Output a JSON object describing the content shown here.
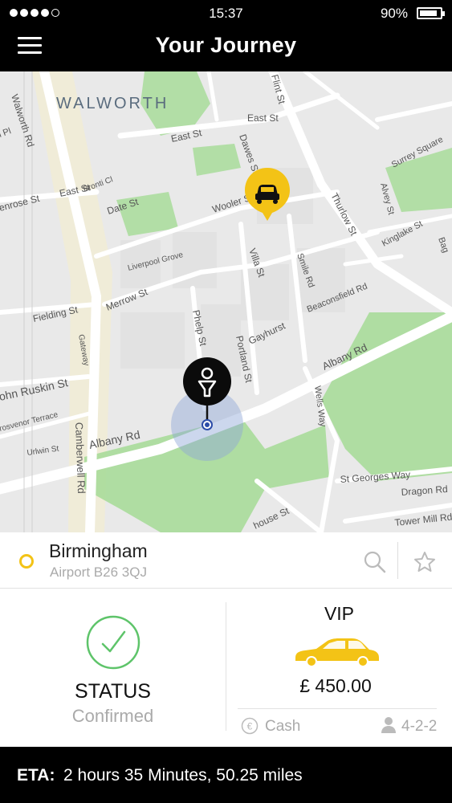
{
  "status_bar": {
    "time": "15:37",
    "battery": "90%",
    "battery_level": 0.9
  },
  "header": {
    "title": "Your Journey",
    "menu_icon": "hamburger-menu-icon"
  },
  "map": {
    "labels": {
      "walworth": "WALWORTH",
      "walworth_rd": "Walworth Rd",
      "flint_st": "Flint St",
      "east_st_top": "East St",
      "east_st_mid": "East St",
      "east_st_left": "East St",
      "bronti_cl": "Bronti Cl",
      "date_st": "Date St",
      "dawes_st": "Dawes St",
      "surrey_square": "Surrey Square",
      "alvey_st": "Alvey St",
      "kinglake_st": "Kinglake St",
      "thurlow_st": "Thurlow St",
      "wooler_st": "Wooler St",
      "penrose_st": "enrose St",
      "liverpool_grove": "Liverpool Grove",
      "villa_st": "Villa St",
      "smile_rd": "Smile Rd",
      "beaconsfield_rd": "Beaconsfield Rd",
      "merrow_st": "Merrow St",
      "fielding_st": "Fielding St",
      "phelp_st": "Phelp St",
      "portland_st": "Portland St",
      "gayhurst": "Gayhurst",
      "albany_rd_right": "Albany Rd",
      "gateway": "Gateway",
      "john_ruskin_st": "ohn Ruskin St",
      "grosvenor_terrace": "rosvenor Terrace",
      "urlwin_st": "Urlwin St",
      "albany_rd_left": "Albany Rd",
      "camberwell_rd": "Camberwell Rd",
      "wells_way": "Wells Way",
      "st_georges_way": "St Georges Way",
      "dragon_rd": "Dragon Rd",
      "tower_mill_rd": "Tower Mill Rd",
      "house_st": "house St",
      "pl_st": "l Pl",
      "bagshot": "Bag"
    },
    "taxi_pin_icon": "taxi-pin-icon",
    "user_pin_icon": "user-location-pin-icon"
  },
  "location": {
    "title": "Birmingham",
    "subtitle": "Airport B26 3QJ",
    "search_icon": "search-icon",
    "favorite_icon": "star-icon"
  },
  "status": {
    "icon": "check-circle-icon",
    "label": "STATUS",
    "value": "Confirmed"
  },
  "vehicle": {
    "class": "VIP",
    "icon": "car-icon",
    "price": "£ 450.00",
    "payment": "Cash",
    "payment_icon": "euro-coin-icon",
    "passengers": "4-2-2",
    "passengers_icon": "person-icon"
  },
  "eta": {
    "label": "ETA:",
    "value": "2 hours 35 Minutes, 50.25 miles"
  },
  "colors": {
    "accent": "#f3c316",
    "success": "#5ec46a",
    "park": "#a8dc9a",
    "header": "#000000"
  }
}
